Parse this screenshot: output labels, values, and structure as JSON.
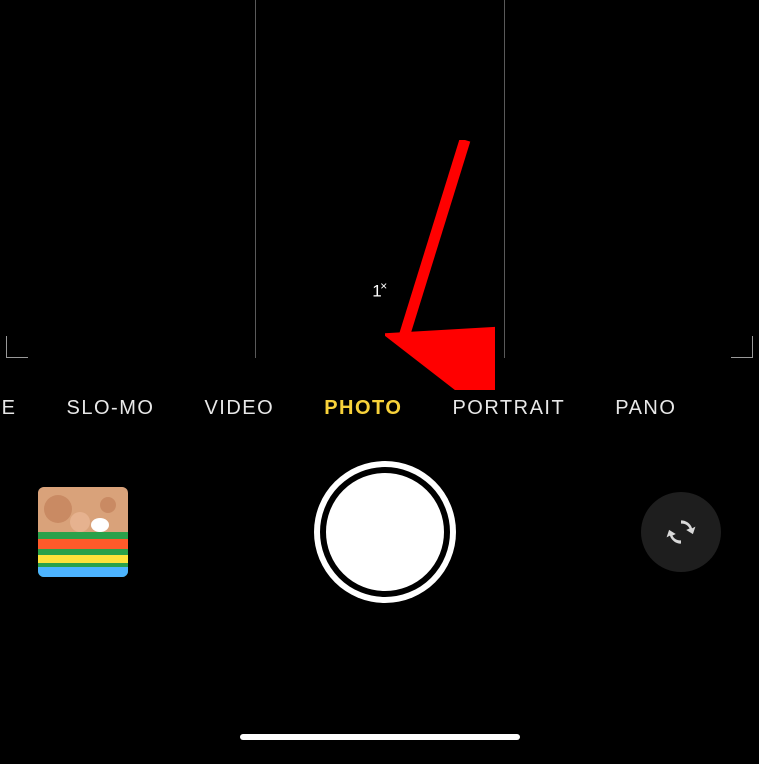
{
  "viewfinder": {
    "zoom_label": "1",
    "zoom_suffix": "×"
  },
  "modes": {
    "items": [
      {
        "label": "PSE",
        "active": false
      },
      {
        "label": "SLO-MO",
        "active": false
      },
      {
        "label": "VIDEO",
        "active": false
      },
      {
        "label": "PHOTO",
        "active": true
      },
      {
        "label": "PORTRAIT",
        "active": false
      },
      {
        "label": "PANO",
        "active": false
      }
    ]
  },
  "controls": {
    "thumbnail_alt": "last-photo",
    "shutter": "shutter",
    "flip": "flip-camera"
  },
  "annotation": {
    "arrow_color": "#ff0000"
  }
}
